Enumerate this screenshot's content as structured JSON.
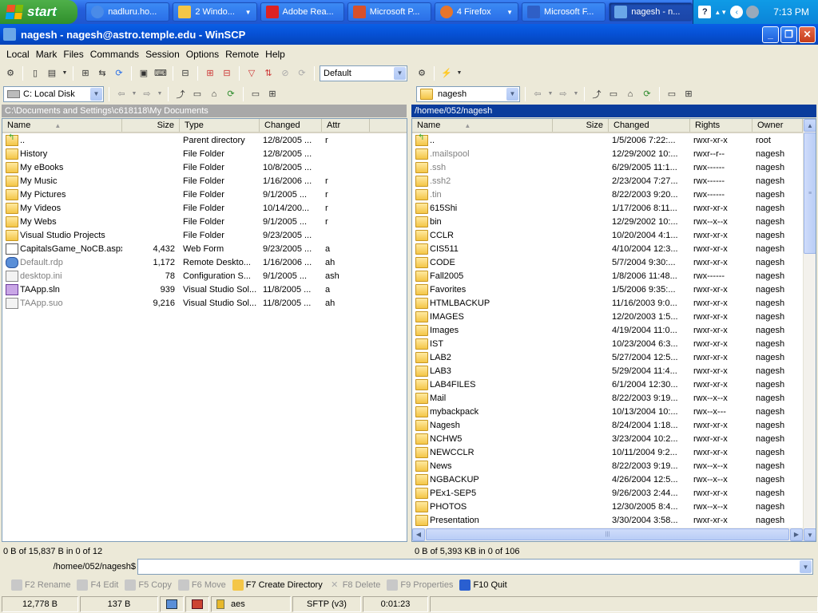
{
  "taskbar": {
    "start_label": "start",
    "buttons": [
      {
        "label": "nadluru.ho...",
        "icon": "ie-icon"
      },
      {
        "label": "2 Windo...",
        "icon": "folder-icon"
      },
      {
        "label": "Adobe Rea...",
        "icon": "acrobat-icon"
      },
      {
        "label": "Microsoft P...",
        "icon": "powerpoint-icon"
      },
      {
        "label": "4 Firefox",
        "icon": "firefox-icon"
      },
      {
        "label": "Microsoft F...",
        "icon": "frontpage-icon"
      },
      {
        "label": "nagesh - n...",
        "icon": "winscp-icon"
      }
    ],
    "clock": "7:13 PM"
  },
  "window": {
    "title": "nagesh - nagesh@astro.temple.edu - WinSCP"
  },
  "menu": [
    "Local",
    "Mark",
    "Files",
    "Commands",
    "Session",
    "Options",
    "Remote",
    "Help"
  ],
  "toolbar": {
    "session_combo": "Default"
  },
  "left": {
    "drive": "C: Local Disk",
    "path": "C:\\Documents and Settings\\c618118\\My Documents",
    "columns": [
      "Name",
      "Size",
      "Type",
      "Changed",
      "Attr"
    ],
    "rows": [
      {
        "name": "..",
        "size": "",
        "type": "Parent directory",
        "changed": "12/8/2005 ...",
        "attr": "r",
        "icon": "up"
      },
      {
        "name": "History",
        "size": "",
        "type": "File Folder",
        "changed": "12/8/2005 ...",
        "attr": "",
        "icon": "fold"
      },
      {
        "name": "My eBooks",
        "size": "",
        "type": "File Folder",
        "changed": "10/8/2005 ...",
        "attr": "",
        "icon": "fold"
      },
      {
        "name": "My Music",
        "size": "",
        "type": "File Folder",
        "changed": "1/16/2006 ...",
        "attr": "r",
        "icon": "fold"
      },
      {
        "name": "My Pictures",
        "size": "",
        "type": "File Folder",
        "changed": "9/1/2005 ...",
        "attr": "r",
        "icon": "fold"
      },
      {
        "name": "My Videos",
        "size": "",
        "type": "File Folder",
        "changed": "10/14/200...",
        "attr": "r",
        "icon": "fold"
      },
      {
        "name": "My Webs",
        "size": "",
        "type": "File Folder",
        "changed": "9/1/2005 ...",
        "attr": "r",
        "icon": "fold"
      },
      {
        "name": "Visual Studio Projects",
        "size": "",
        "type": "File Folder",
        "changed": "9/23/2005 ...",
        "attr": "",
        "icon": "fold"
      },
      {
        "name": "CapitalsGame_NoCB.aspx",
        "size": "4,432",
        "type": "Web Form",
        "changed": "9/23/2005 ...",
        "attr": "a",
        "icon": "doc"
      },
      {
        "name": "Default.rdp",
        "size": "1,172",
        "type": "Remote Deskto...",
        "changed": "1/16/2006 ...",
        "attr": "ah",
        "icon": "rdp",
        "dim": true
      },
      {
        "name": "desktop.ini",
        "size": "78",
        "type": "Configuration S...",
        "changed": "9/1/2005 ...",
        "attr": "ash",
        "icon": "ini",
        "dim": true
      },
      {
        "name": "TAApp.sln",
        "size": "939",
        "type": "Visual Studio Sol...",
        "changed": "11/8/2005 ...",
        "attr": "a",
        "icon": "sln"
      },
      {
        "name": "TAApp.suo",
        "size": "9,216",
        "type": "Visual Studio Sol...",
        "changed": "11/8/2005 ...",
        "attr": "ah",
        "icon": "ini",
        "dim": true
      }
    ],
    "status": "0 B of 15,837 B in 0 of 12"
  },
  "right": {
    "dir": "nagesh",
    "path": "/homee/052/nagesh",
    "columns": [
      "Name",
      "Size",
      "Changed",
      "Rights",
      "Owner"
    ],
    "rows": [
      {
        "name": "..",
        "changed": "1/5/2006 7:22:...",
        "rights": "rwxr-xr-x",
        "owner": "root",
        "icon": "up"
      },
      {
        "name": ".mailspool",
        "changed": "12/29/2002 10:...",
        "rights": "rwxr--r--",
        "owner": "nagesh",
        "icon": "fold",
        "dim": true
      },
      {
        "name": ".ssh",
        "changed": "6/29/2005 11:1...",
        "rights": "rwx------",
        "owner": "nagesh",
        "icon": "fold",
        "dim": true
      },
      {
        "name": ".ssh2",
        "changed": "2/23/2004 7:27...",
        "rights": "rwx------",
        "owner": "nagesh",
        "icon": "fold",
        "dim": true
      },
      {
        "name": ".tin",
        "changed": "8/22/2003 9:20...",
        "rights": "rwx------",
        "owner": "nagesh",
        "icon": "fold",
        "dim": true
      },
      {
        "name": "615Shi",
        "changed": "1/17/2006 8:11...",
        "rights": "rwxr-xr-x",
        "owner": "nagesh",
        "icon": "fold"
      },
      {
        "name": "bin",
        "changed": "12/29/2002 10:...",
        "rights": "rwx--x--x",
        "owner": "nagesh",
        "icon": "fold"
      },
      {
        "name": "CCLR",
        "changed": "10/20/2004 4:1...",
        "rights": "rwxr-xr-x",
        "owner": "nagesh",
        "icon": "fold"
      },
      {
        "name": "CIS511",
        "changed": "4/10/2004 12:3...",
        "rights": "rwxr-xr-x",
        "owner": "nagesh",
        "icon": "fold"
      },
      {
        "name": "CODE",
        "changed": "5/7/2004 9:30:...",
        "rights": "rwxr-xr-x",
        "owner": "nagesh",
        "icon": "fold"
      },
      {
        "name": "Fall2005",
        "changed": "1/8/2006 11:48...",
        "rights": "rwx------",
        "owner": "nagesh",
        "icon": "fold"
      },
      {
        "name": "Favorites",
        "changed": "1/5/2006 9:35:...",
        "rights": "rwxr-xr-x",
        "owner": "nagesh",
        "icon": "fold"
      },
      {
        "name": "HTMLBACKUP",
        "changed": "11/16/2003 9:0...",
        "rights": "rwxr-xr-x",
        "owner": "nagesh",
        "icon": "fold"
      },
      {
        "name": "IMAGES",
        "changed": "12/20/2003 1:5...",
        "rights": "rwxr-xr-x",
        "owner": "nagesh",
        "icon": "fold"
      },
      {
        "name": "Images",
        "changed": "4/19/2004 11:0...",
        "rights": "rwxr-xr-x",
        "owner": "nagesh",
        "icon": "fold"
      },
      {
        "name": "IST",
        "changed": "10/23/2004 6:3...",
        "rights": "rwxr-xr-x",
        "owner": "nagesh",
        "icon": "fold"
      },
      {
        "name": "LAB2",
        "changed": "5/27/2004 12:5...",
        "rights": "rwxr-xr-x",
        "owner": "nagesh",
        "icon": "fold"
      },
      {
        "name": "LAB3",
        "changed": "5/29/2004 11:4...",
        "rights": "rwxr-xr-x",
        "owner": "nagesh",
        "icon": "fold"
      },
      {
        "name": "LAB4FILES",
        "changed": "6/1/2004 12:30...",
        "rights": "rwxr-xr-x",
        "owner": "nagesh",
        "icon": "fold"
      },
      {
        "name": "Mail",
        "changed": "8/22/2003 9:19...",
        "rights": "rwx--x--x",
        "owner": "nagesh",
        "icon": "fold"
      },
      {
        "name": "mybackpack",
        "changed": "10/13/2004 10:...",
        "rights": "rwx--x---",
        "owner": "nagesh",
        "icon": "fold"
      },
      {
        "name": "Nagesh",
        "changed": "8/24/2004 1:18...",
        "rights": "rwxr-xr-x",
        "owner": "nagesh",
        "icon": "fold"
      },
      {
        "name": "NCHW5",
        "changed": "3/23/2004 10:2...",
        "rights": "rwxr-xr-x",
        "owner": "nagesh",
        "icon": "fold"
      },
      {
        "name": "NEWCCLR",
        "changed": "10/11/2004 9:2...",
        "rights": "rwxr-xr-x",
        "owner": "nagesh",
        "icon": "fold"
      },
      {
        "name": "News",
        "changed": "8/22/2003 9:19...",
        "rights": "rwx--x--x",
        "owner": "nagesh",
        "icon": "fold"
      },
      {
        "name": "NGBACKUP",
        "changed": "4/26/2004 12:5...",
        "rights": "rwx--x--x",
        "owner": "nagesh",
        "icon": "fold"
      },
      {
        "name": "PEx1-SEP5",
        "changed": "9/26/2003 2:44...",
        "rights": "rwxr-xr-x",
        "owner": "nagesh",
        "icon": "fold"
      },
      {
        "name": "PHOTOS",
        "changed": "12/30/2005 8:4...",
        "rights": "rwx--x--x",
        "owner": "nagesh",
        "icon": "fold"
      },
      {
        "name": "Presentation",
        "changed": "3/30/2004 3:58...",
        "rights": "rwxr-xr-x",
        "owner": "nagesh",
        "icon": "fold"
      }
    ],
    "status": "0 B of 5,393 KB in 0 of 106"
  },
  "command": {
    "prompt": "/homee/052/nagesh$",
    "value": ""
  },
  "fkeys": [
    {
      "label": "F2 Rename",
      "on": false
    },
    {
      "label": "F4 Edit",
      "on": false
    },
    {
      "label": "F5 Copy",
      "on": false
    },
    {
      "label": "F6 Move",
      "on": false
    },
    {
      "label": "F7 Create Directory",
      "on": true
    },
    {
      "label": "F8 Delete",
      "on": false
    },
    {
      "label": "F9 Properties",
      "on": false
    },
    {
      "label": "F10 Quit",
      "on": true
    }
  ],
  "statusbar": {
    "bytes_sent": "12,778 B",
    "bytes_recv": "137 B",
    "cipher": "aes",
    "protocol": "SFTP (v3)",
    "elapsed": "0:01:23"
  }
}
